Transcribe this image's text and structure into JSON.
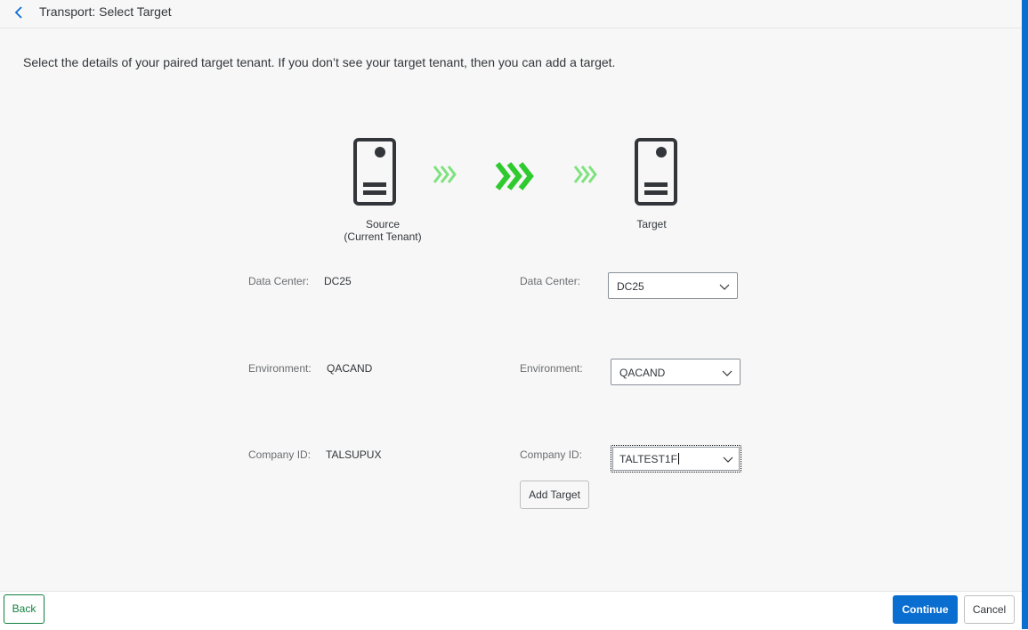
{
  "header": {
    "title": "Transport: Select Target",
    "back_icon": "chevron-left-icon"
  },
  "intro_text": "Select the details of your paired target tenant. If you don’t see your target tenant, then you can add a target.",
  "diagram": {
    "source_label_line1": "Source",
    "source_label_line2": "(Current Tenant)",
    "target_label": "Target",
    "server_icon": "server-icon",
    "arrow_icon": "triple-chevron-right-icon",
    "colors": {
      "arrow_light": "#7ee27e",
      "arrow_strong": "#2fca2f",
      "server": "#32363a"
    }
  },
  "source": {
    "data_center_label": "Data Center:",
    "data_center_value": "DC25",
    "environment_label": "Environment:",
    "environment_value": "QACAND",
    "company_label": "Company ID:",
    "company_value": "TALSUPUX"
  },
  "target": {
    "data_center_label": "Data Center:",
    "data_center_value": "DC25",
    "environment_label": "Environment:",
    "environment_value": "QACAND",
    "company_label": "Company ID:",
    "company_value": "TALTEST1F",
    "add_target_label": "Add Target"
  },
  "footer": {
    "back_label": "Back",
    "continue_label": "Continue",
    "cancel_label": "Cancel",
    "colors": {
      "primary": "#0a6ed1",
      "back_border": "#107e3e"
    }
  }
}
